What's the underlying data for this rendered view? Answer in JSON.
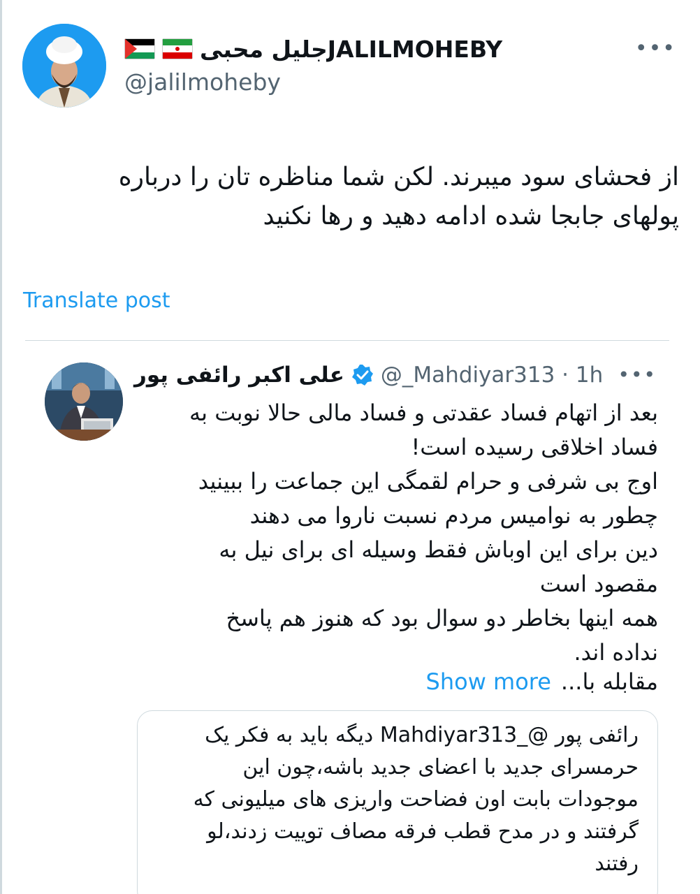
{
  "post": {
    "display_name": "جلیل محبیJALILMOHEBY",
    "handle": "@jalilmoheby",
    "flags": [
      "palestine-flag",
      "iran-flag"
    ],
    "more_label": "•••",
    "text_line1": "از فحشای سود میبرند. لکن شما مناظره تان را درباره",
    "text_line2": "پولهای جابجا شده ادامه دهید و رها نکنید",
    "translate_label": "Translate post"
  },
  "quoted": {
    "display_name": "علی اکبر رائفی پور",
    "handle_time": "@_Mahdiyar313 · 1h",
    "more_label": "•••",
    "lines": [
      "بعد از اتهام فساد عقدتی و فساد مالی حالا نوبت به",
      "فساد اخلاقی رسیده است!",
      "اوج بی شرفی و حرام لقمگی این جماعت را ببینید",
      "چطور به نوامیس مردم نسبت ناروا می دهند",
      "دین برای این اوباش فقط وسیله ای برای نیل به",
      "مقصود است",
      "همه اینها بخاطر دو سوال بود که هنوز هم پاسخ",
      "نداده اند."
    ],
    "last_line": "مقابله با...",
    "show_more_label": "Show more",
    "nested_lines": [
      "رائفی پور @_Mahdiyar313 دیگه باید به فکر یک",
      "حرمسرای جدید با اعضای جدید باشه،چون این",
      "موجودات بابت اون فضاحت واریزی های میلیونی که",
      "گرفتند و در مدح قطب فرقه مصاف توییت زدند،لو",
      "رفتند"
    ]
  },
  "colors": {
    "accent": "#1d9bf0",
    "text": "#0f1419",
    "muted": "#536471",
    "border": "#cfd9de"
  }
}
